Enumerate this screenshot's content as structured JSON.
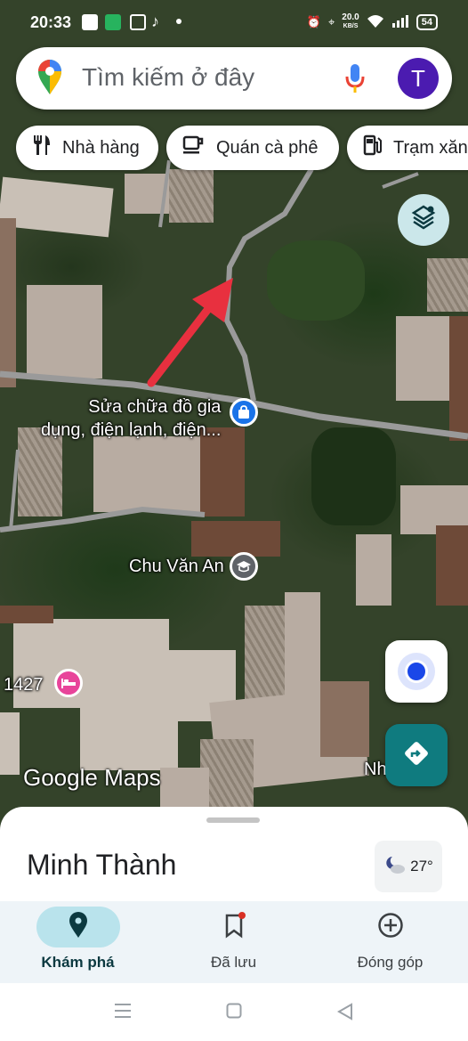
{
  "status_bar": {
    "time": "20:33",
    "network_speed": "20.0",
    "network_speed_unit": "KB/S",
    "battery": "54"
  },
  "search": {
    "placeholder": "Tìm kiếm ở đây",
    "avatar_initial": "T"
  },
  "chips": [
    {
      "label": "Nhà hàng",
      "icon": "fork-knife-icon"
    },
    {
      "label": "Quán cà phê",
      "icon": "coffee-cup-icon"
    },
    {
      "label": "Trạm xăng",
      "icon": "gas-pump-icon"
    }
  ],
  "map": {
    "places": [
      {
        "name_line1": "Sửa chữa đồ gia",
        "name_line2": "dụng, điện lạnh, điện...",
        "icon": "shopping-bag-icon",
        "color": "#1a73e8"
      },
      {
        "name": "Chu Văn An",
        "icon": "school-cap-icon",
        "color": "#5f6368"
      },
      {
        "name": "1427",
        "icon": "hotel-bed-icon",
        "color": "#e8449a"
      },
      {
        "name": "Nh...ọc",
        "icon": "place-label-clipped"
      }
    ],
    "logo_text": "Google Maps",
    "accent": "#0f7b7f",
    "arrow_color": "#e8303f"
  },
  "sheet": {
    "area_name": "Minh Thành",
    "temperature": "27°",
    "weather_icon": "moon-cloud-icon"
  },
  "nav": [
    {
      "label": "Khám phá",
      "icon": "location-pin-icon",
      "active": true
    },
    {
      "label": "Đã lưu",
      "icon": "bookmark-icon",
      "active": false
    },
    {
      "label": "Đóng góp",
      "icon": "plus-circle-icon",
      "active": false
    }
  ]
}
